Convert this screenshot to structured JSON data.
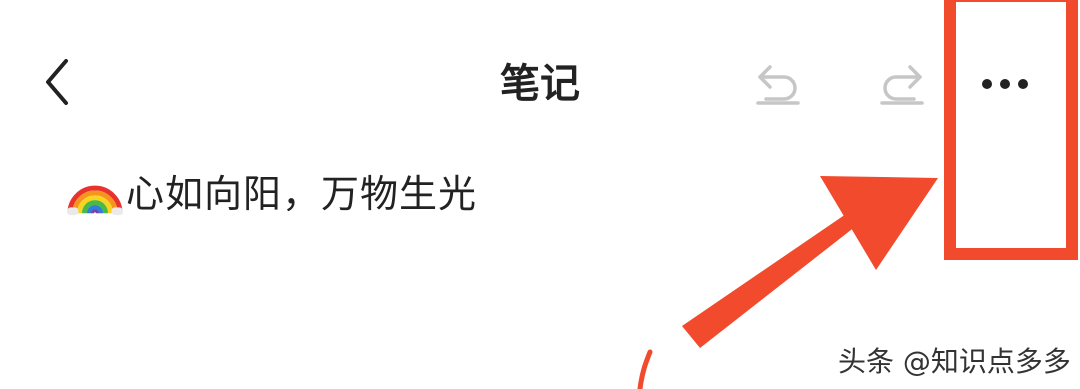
{
  "header": {
    "title": "笔记",
    "back_icon": "chevron-left-icon",
    "undo_icon": "undo-icon",
    "redo_icon": "redo-icon",
    "more_icon": "more-horizontal-icon"
  },
  "note": {
    "emoji_icon": "rainbow-icon",
    "text": "心如向阳，万物生光"
  },
  "annotation": {
    "color": "#f24a2c"
  },
  "watermark": {
    "text": "头条 @知识点多多"
  },
  "colors": {
    "text_primary": "#222222",
    "icon_disabled": "#c6c6c6",
    "annotation_red": "#f24a2c"
  }
}
